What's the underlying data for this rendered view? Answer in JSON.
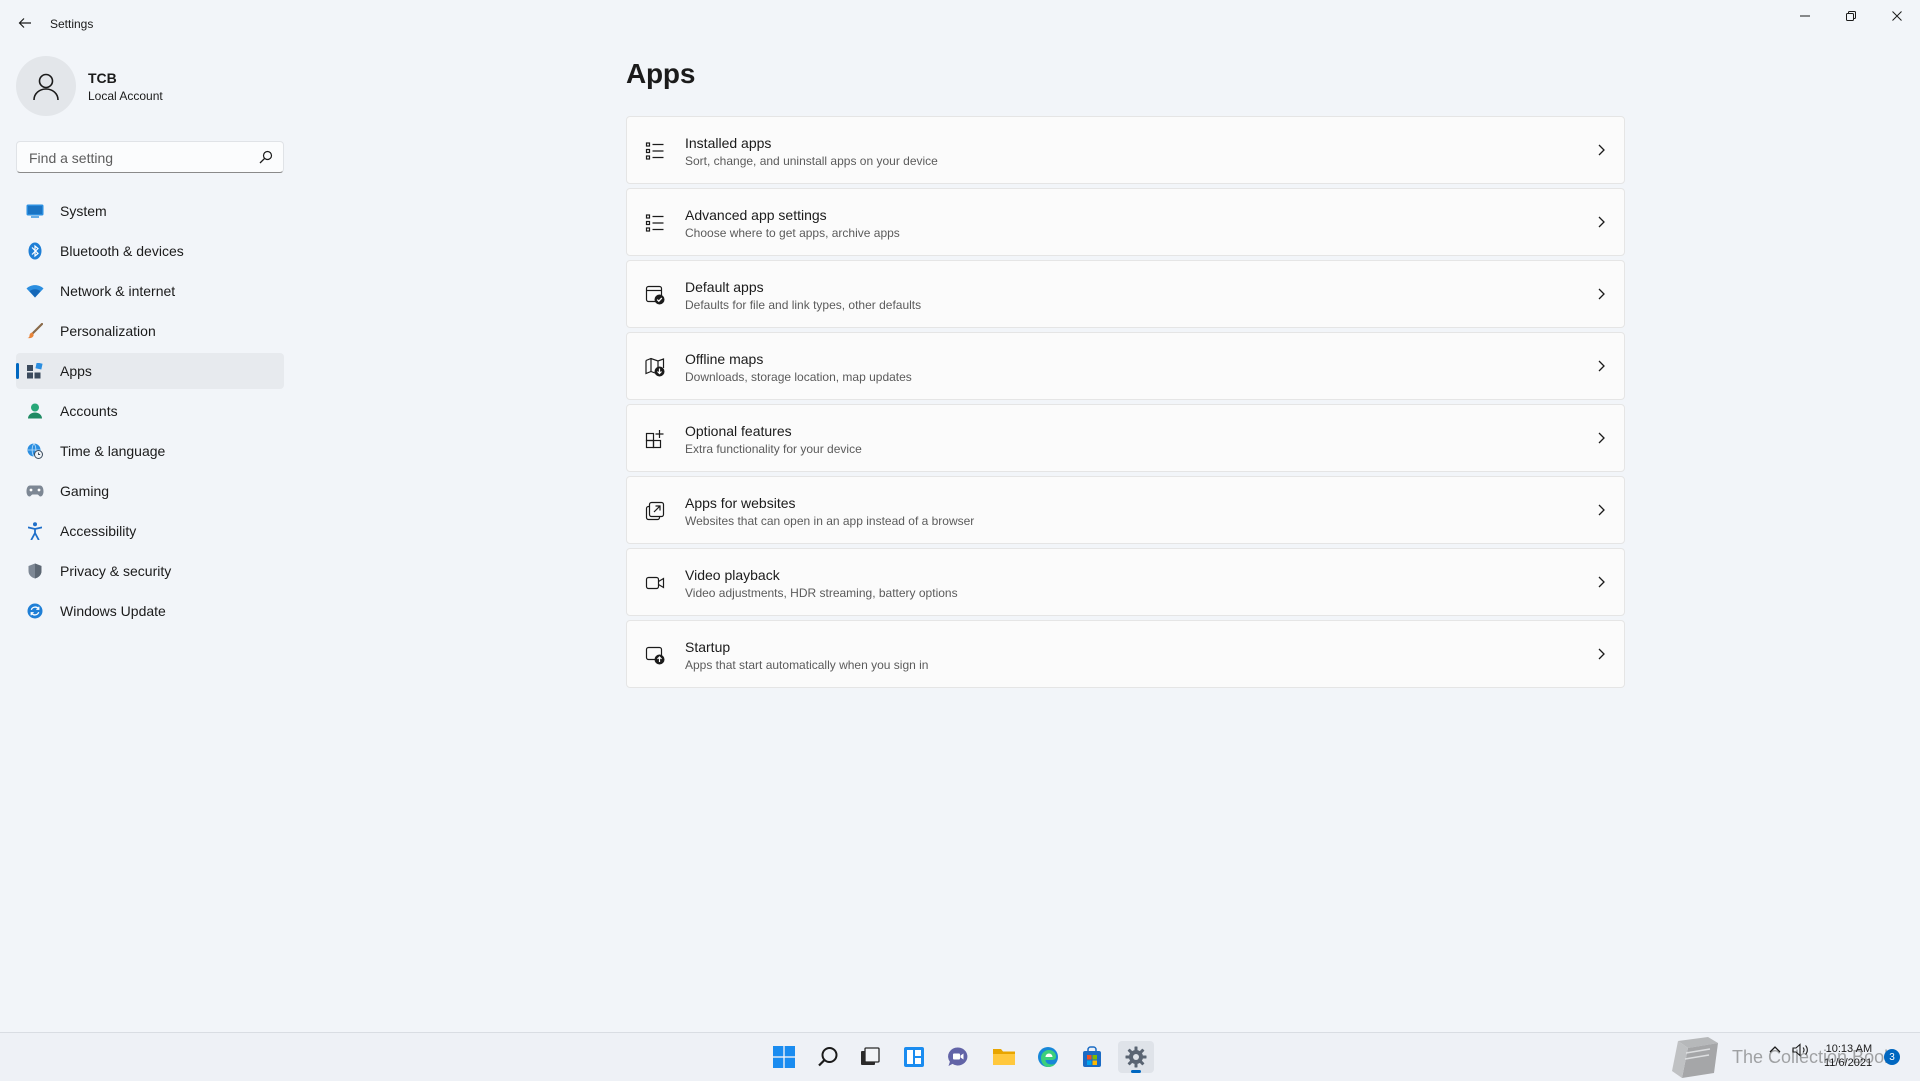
{
  "window": {
    "title": "Settings"
  },
  "profile": {
    "name": "TCB",
    "account_type": "Local Account"
  },
  "search": {
    "placeholder": "Find a setting"
  },
  "nav": {
    "items": [
      {
        "label": "System",
        "icon": "monitor-icon"
      },
      {
        "label": "Bluetooth & devices",
        "icon": "bluetooth-icon"
      },
      {
        "label": "Network & internet",
        "icon": "wifi-icon"
      },
      {
        "label": "Personalization",
        "icon": "brush-icon"
      },
      {
        "label": "Apps",
        "icon": "apps-icon",
        "active": true
      },
      {
        "label": "Accounts",
        "icon": "person-icon"
      },
      {
        "label": "Time & language",
        "icon": "globe-clock-icon"
      },
      {
        "label": "Gaming",
        "icon": "gamepad-icon"
      },
      {
        "label": "Accessibility",
        "icon": "accessibility-icon"
      },
      {
        "label": "Privacy & security",
        "icon": "shield-icon"
      },
      {
        "label": "Windows Update",
        "icon": "update-icon"
      }
    ]
  },
  "main": {
    "title": "Apps",
    "cards": [
      {
        "title": "Installed apps",
        "subtitle": "Sort, change, and uninstall apps on your device",
        "icon": "list-icon"
      },
      {
        "title": "Advanced app settings",
        "subtitle": "Choose where to get apps, archive apps",
        "icon": "list-settings-icon"
      },
      {
        "title": "Default apps",
        "subtitle": "Defaults for file and link types, other defaults",
        "icon": "default-apps-icon"
      },
      {
        "title": "Offline maps",
        "subtitle": "Downloads, storage location, map updates",
        "icon": "map-download-icon"
      },
      {
        "title": "Optional features",
        "subtitle": "Extra functionality for your device",
        "icon": "grid-plus-icon"
      },
      {
        "title": "Apps for websites",
        "subtitle": "Websites that can open in an app instead of a browser",
        "icon": "open-external-icon"
      },
      {
        "title": "Video playback",
        "subtitle": "Video adjustments, HDR streaming, battery options",
        "icon": "video-camera-icon"
      },
      {
        "title": "Startup",
        "subtitle": "Apps that start automatically when you sign in",
        "icon": "startup-icon"
      }
    ]
  },
  "taskbar": {
    "clock_time": "10:13 AM",
    "clock_date": "11/6/2021",
    "notification_count": "3",
    "watermark_text": "The Collection Book",
    "accent": "#0067c0"
  }
}
